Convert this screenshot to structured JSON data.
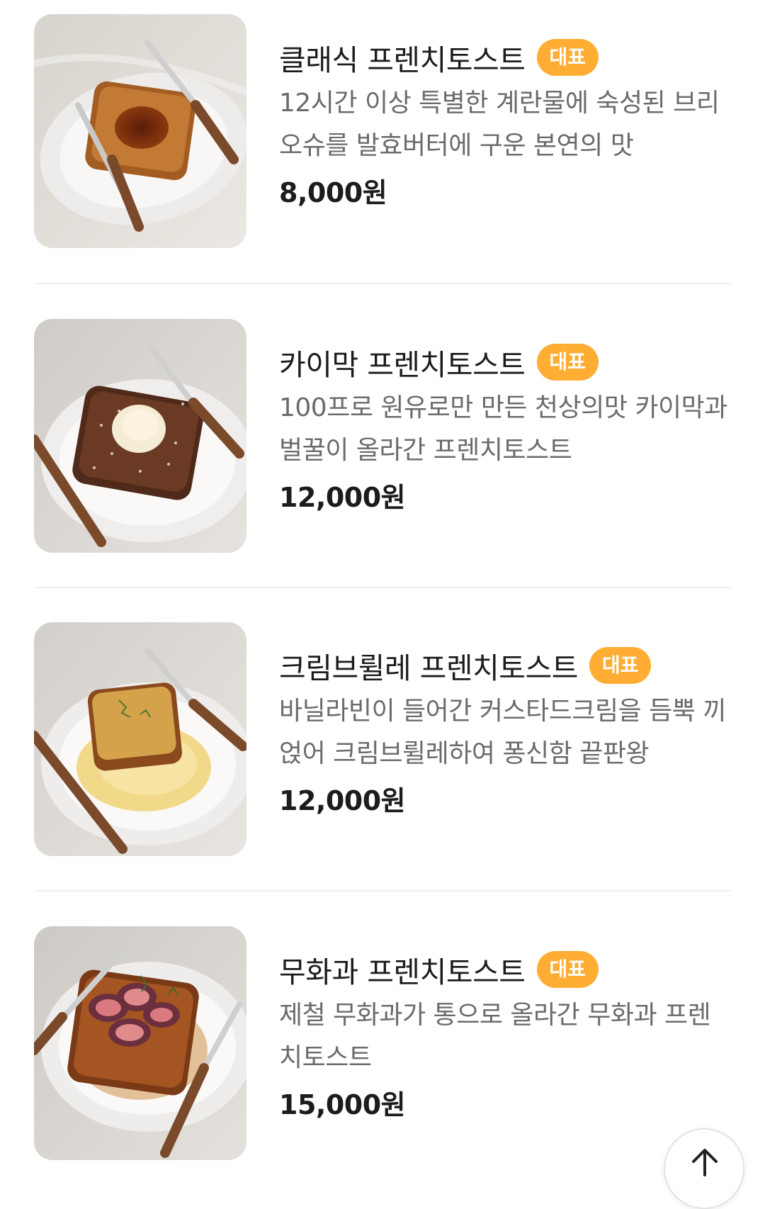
{
  "menu": {
    "items": [
      {
        "name": "클래식 프렌치토스트",
        "badge": "대표",
        "description": "12시간 이상 특별한 계란물에 숙성된 브리오슈를 발효버터에 구운 본연의 맛",
        "price": "8,000원",
        "image_icon": "classic-french-toast-photo"
      },
      {
        "name": "카이막 프렌치토스트",
        "badge": "대표",
        "description": "100프로 원유로만 만든 천상의맛 카이막과 벌꿀이 올라간 프렌치토스트",
        "price": "12,000원",
        "image_icon": "kaymak-french-toast-photo"
      },
      {
        "name": "크림브륄레 프렌치토스트",
        "badge": "대표",
        "description": "바닐라빈이 들어간 커스타드크림을 듬뿍 끼얹어 크림브륄레하여 퐁신함 끝판왕",
        "price": "12,000원",
        "image_icon": "creme-brulee-french-toast-photo"
      },
      {
        "name": "무화과 프렌치토스트",
        "badge": "대표",
        "description": "제철 무화과가 통으로 올라간 무화과 프렌치토스트",
        "price": "15,000원",
        "image_icon": "fig-french-toast-photo"
      }
    ]
  },
  "scroll_top": {
    "icon": "arrow-up-icon"
  },
  "colors": {
    "badge": "#ffad33",
    "description": "#6b6b6b",
    "title": "#1c1c1c",
    "divider": "#f0f0f0"
  }
}
